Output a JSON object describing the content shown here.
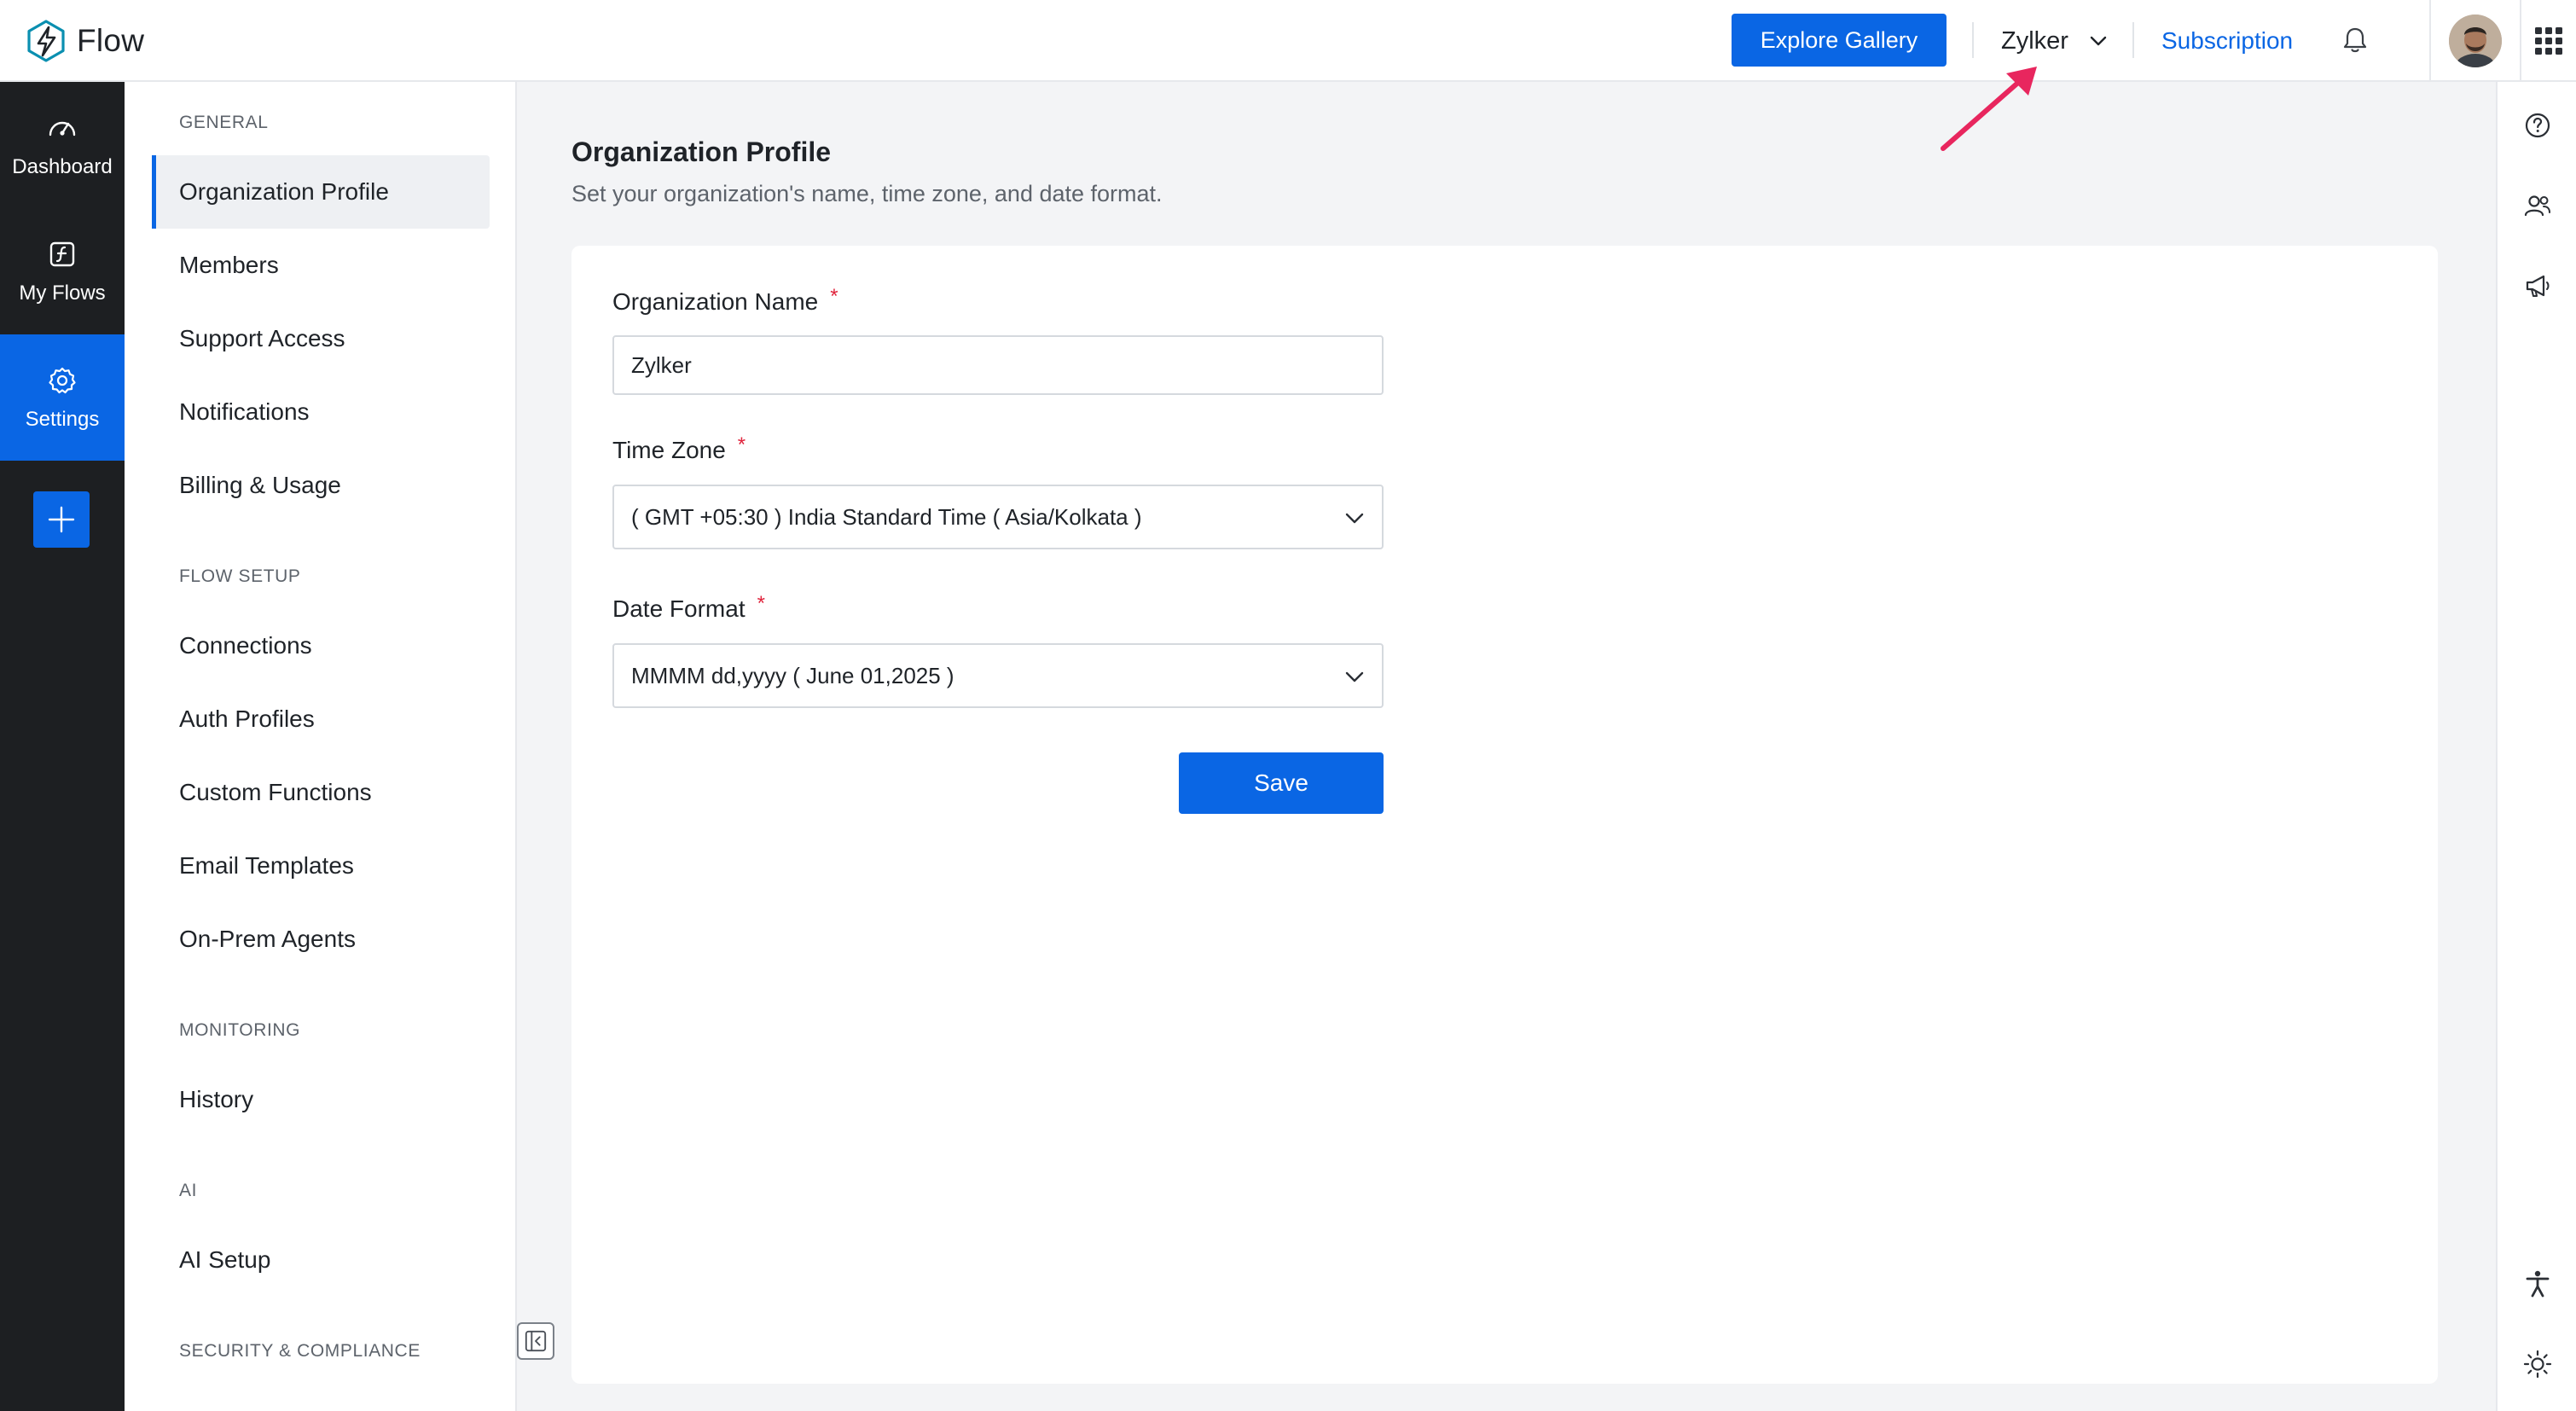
{
  "app": {
    "name": "Flow"
  },
  "topbar": {
    "explore_label": "Explore Gallery",
    "org_name": "Zylker",
    "subscription_label": "Subscription"
  },
  "leftnav": {
    "items": [
      {
        "label": "Dashboard",
        "icon": "speedometer-icon"
      },
      {
        "label": "My Flows",
        "icon": "flow-function-icon"
      },
      {
        "label": "Settings",
        "icon": "gear-icon",
        "active": true
      }
    ]
  },
  "sidebar": {
    "sections": [
      {
        "heading": "GENERAL",
        "items": [
          "Organization Profile",
          "Members",
          "Support Access",
          "Notifications",
          "Billing & Usage"
        ]
      },
      {
        "heading": "FLOW SETUP",
        "items": [
          "Connections",
          "Auth Profiles",
          "Custom Functions",
          "Email Templates",
          "On-Prem Agents"
        ]
      },
      {
        "heading": "MONITORING",
        "items": [
          "History"
        ]
      },
      {
        "heading": "AI",
        "items": [
          "AI Setup"
        ]
      },
      {
        "heading": "SECURITY & COMPLIANCE",
        "items": []
      }
    ],
    "active_item": "Organization Profile"
  },
  "main": {
    "title": "Organization Profile",
    "subtitle": "Set your organization's name, time zone, and date format.",
    "form": {
      "org_name_label": "Organization Name",
      "org_name_value": "Zylker",
      "timezone_label": "Time Zone",
      "timezone_value": "( GMT +05:30 ) India Standard Time ( Asia/Kolkata )",
      "date_format_label": "Date Format",
      "date_format_value": "MMMM dd,yyyy ( June 01,2025 )",
      "required_mark": "*",
      "save_label": "Save"
    }
  },
  "colors": {
    "accent": "#0a66e4",
    "nav_bg": "#1d1f22",
    "required": "#e0243c",
    "annotation_arrow": "#e8265e"
  }
}
